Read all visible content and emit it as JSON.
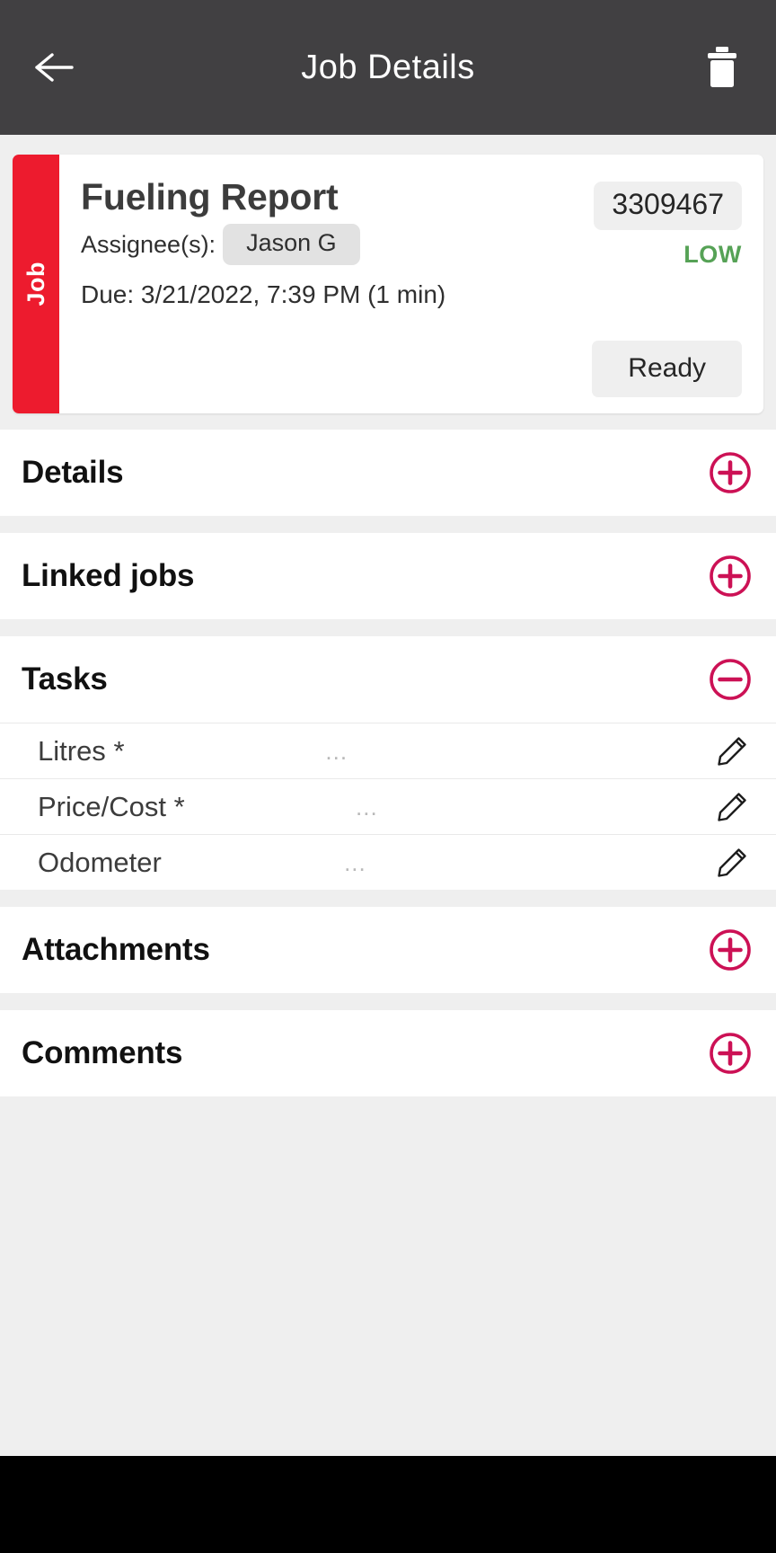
{
  "appbar": {
    "title": "Job Details",
    "back_icon": "arrow-left-icon",
    "delete_icon": "trash-icon"
  },
  "job_card": {
    "tab_label": "Job",
    "title": "Fueling Report",
    "assignee_label": "Assignee(s):",
    "assignee_name": "Jason G",
    "due_text": "Due: 3/21/2022, 7:39 PM (1 min)",
    "job_id": "3309467",
    "priority": "LOW",
    "status": "Ready",
    "accent_color": "#ed1b2e",
    "priority_color": "#56a256"
  },
  "sections": [
    {
      "title": "Details",
      "expanded": false,
      "toggle_icon": "plus-circle-icon"
    },
    {
      "title": "Linked jobs",
      "expanded": false,
      "toggle_icon": "plus-circle-icon"
    },
    {
      "title": "Tasks",
      "expanded": true,
      "toggle_icon": "minus-circle-icon"
    },
    {
      "title": "Attachments",
      "expanded": false,
      "toggle_icon": "plus-circle-icon"
    },
    {
      "title": "Comments",
      "expanded": false,
      "toggle_icon": "plus-circle-icon"
    }
  ],
  "tasks": [
    {
      "label": "Litres",
      "required": "*",
      "value": "...",
      "edit_icon": "pencil-icon"
    },
    {
      "label": "Price/Cost",
      "required": "*",
      "value": "...",
      "edit_icon": "pencil-icon"
    },
    {
      "label": "Odometer",
      "required": "",
      "value": "...",
      "edit_icon": "pencil-icon"
    }
  ],
  "theme": {
    "toggle_color": "#cc1155",
    "appbar_bg": "#414042",
    "page_bg": "#efefef"
  }
}
